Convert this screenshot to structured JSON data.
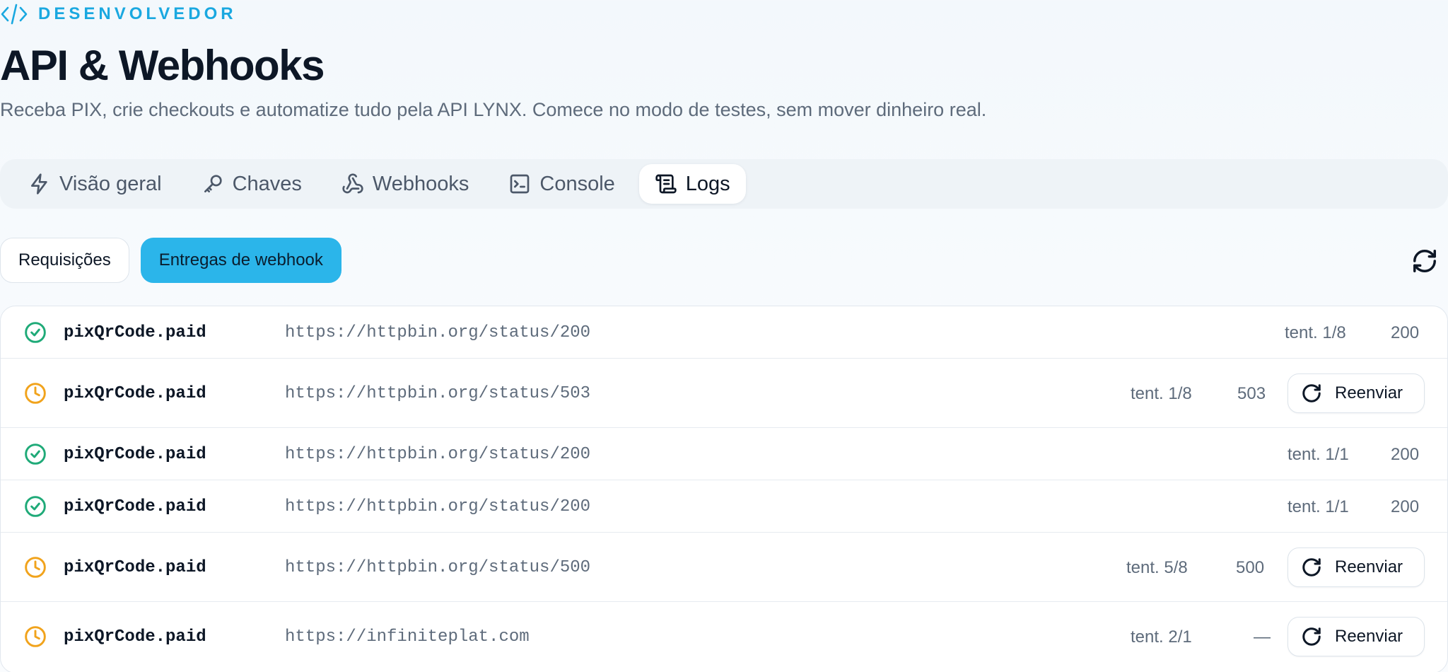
{
  "header": {
    "eyebrow": "DESENVOLVEDOR",
    "title": "API & Webhooks",
    "subtitle": "Receba PIX, crie checkouts e automatize tudo pela API LYNX. Comece no modo de testes, sem mover dinheiro real."
  },
  "tabs": [
    {
      "label": "Visão geral",
      "icon": "bolt-icon",
      "active": false
    },
    {
      "label": "Chaves",
      "icon": "key-icon",
      "active": false
    },
    {
      "label": "Webhooks",
      "icon": "webhook-icon",
      "active": false
    },
    {
      "label": "Console",
      "icon": "terminal-icon",
      "active": false
    },
    {
      "label": "Logs",
      "icon": "scroll-icon",
      "active": true
    }
  ],
  "subtabs": {
    "requests": "Requisições",
    "deliveries": "Entregas de webhook",
    "active": "deliveries"
  },
  "colors": {
    "accent": "#2bb5ea",
    "success": "#1faa78",
    "pending": "#f1a31c"
  },
  "deliveries": [
    {
      "status": "success",
      "icon": "check-circle-icon",
      "event": "pixQrCode.paid",
      "url": "https://httpbin.org/status/200",
      "attempt": "tent. 1/8",
      "code": "200",
      "resend": null
    },
    {
      "status": "pending",
      "icon": "clock-icon",
      "event": "pixQrCode.paid",
      "url": "https://httpbin.org/status/503",
      "attempt": "tent. 1/8",
      "code": "503",
      "resend": "Reenviar"
    },
    {
      "status": "success",
      "icon": "check-circle-icon",
      "event": "pixQrCode.paid",
      "url": "https://httpbin.org/status/200",
      "attempt": "tent. 1/1",
      "code": "200",
      "resend": null
    },
    {
      "status": "success",
      "icon": "check-circle-icon",
      "event": "pixQrCode.paid",
      "url": "https://httpbin.org/status/200",
      "attempt": "tent. 1/1",
      "code": "200",
      "resend": null
    },
    {
      "status": "pending",
      "icon": "clock-icon",
      "event": "pixQrCode.paid",
      "url": "https://httpbin.org/status/500",
      "attempt": "tent. 5/8",
      "code": "500",
      "resend": "Reenviar"
    },
    {
      "status": "pending",
      "icon": "clock-icon",
      "event": "pixQrCode.paid",
      "url": "https://infiniteplat.com",
      "attempt": "tent. 2/1",
      "code": "—",
      "resend": "Reenviar"
    }
  ]
}
